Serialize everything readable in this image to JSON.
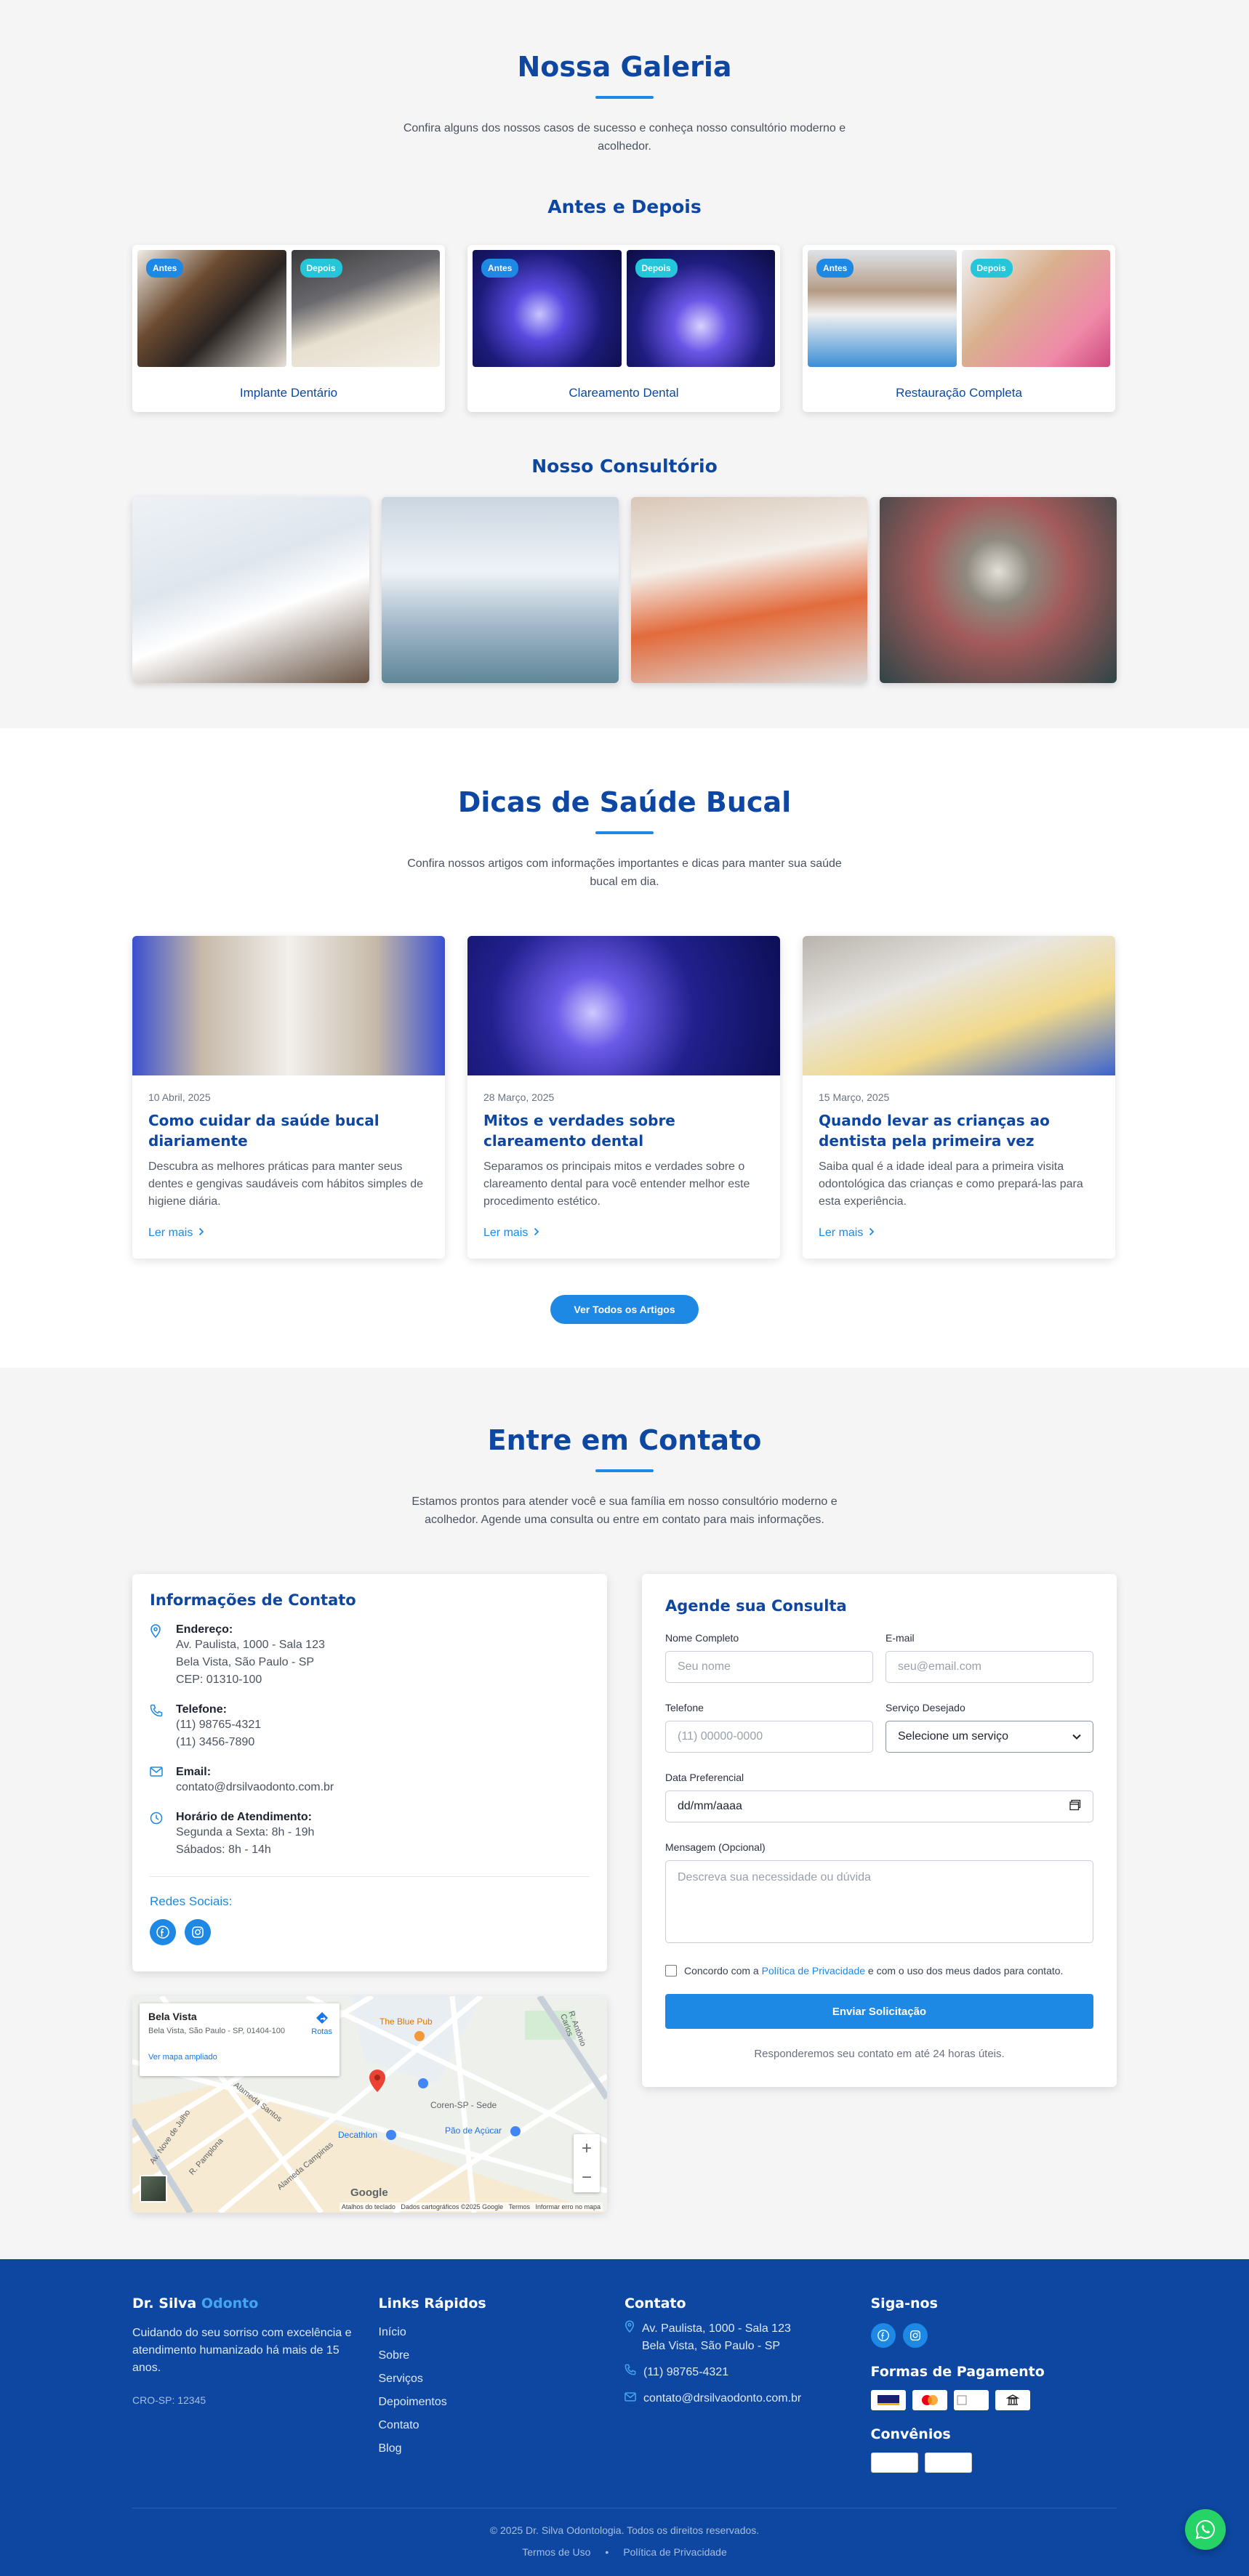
{
  "gallery": {
    "title": "Nossa Galeria",
    "subtitle": "Confira alguns dos nossos casos de sucesso e conheça nosso consultório moderno e acolhedor.",
    "before_after_title": "Antes e Depois",
    "badge_before": "Antes",
    "badge_after": "Depois",
    "cases": [
      {
        "label": "Implante Dentário"
      },
      {
        "label": "Clareamento Dental"
      },
      {
        "label": "Restauração Completa"
      }
    ],
    "office_title": "Nosso Consultório"
  },
  "blog": {
    "title": "Dicas de Saúde Bucal",
    "subtitle": "Confira nossos artigos com informações importantes e dicas para manter sua saúde bucal em dia.",
    "read_more": "Ler mais",
    "posts": [
      {
        "date": "10 Abril, 2025",
        "title": "Como cuidar da saúde bucal diariamente",
        "excerpt": "Descubra as melhores práticas para manter seus dentes e gengivas saudáveis com hábitos simples de higiene diária."
      },
      {
        "date": "28 Março, 2025",
        "title": "Mitos e verdades sobre clareamento dental",
        "excerpt": "Separamos os principais mitos e verdades sobre o clareamento dental para você entender melhor este procedimento estético."
      },
      {
        "date": "15 Março, 2025",
        "title": "Quando levar as crianças ao dentista pela primeira vez",
        "excerpt": "Saiba qual é a idade ideal para a primeira visita odontológica das crianças e como prepará-las para esta experiência."
      }
    ],
    "all_button": "Ver Todos os Artigos"
  },
  "contact": {
    "title": "Entre em Contato",
    "subtitle": "Estamos prontos para atender você e sua família em nosso consultório moderno e acolhedor. Agende uma consulta ou entre em contato para mais informações.",
    "info_title": "Informações de Contato",
    "address_label": "Endereço:",
    "address_lines": [
      "Av. Paulista, 1000 - Sala 123",
      "Bela Vista, São Paulo - SP",
      "CEP: 01310-100"
    ],
    "phone_label": "Telefone:",
    "phone_lines": [
      "(11) 98765-4321",
      "(11) 3456-7890"
    ],
    "email_label": "Email:",
    "email": "contato@drsilvaodonto.com.br",
    "hours_label": "Horário de Atendimento:",
    "hours_lines": [
      "Segunda a Sexta: 8h - 19h",
      "Sábados: 8h - 14h"
    ],
    "social_title": "Redes Sociais:",
    "map": {
      "place": "Bela Vista",
      "place_address": "Bela Vista, São Paulo - SP, 01404-100",
      "directions": "Rotas",
      "larger_map": "Ver mapa ampliado",
      "poi_1": "The Blue Pub",
      "poi_2": "Coren-SP - Sede",
      "poi_3": "Decathlon",
      "poi_4": "Pão de Açúcar",
      "street_1": "Alameda Santos",
      "street_2": "R. Pamplona",
      "street_3": "Alameda Campinas",
      "street_4": "Av. Nove de Julho",
      "street_5": "R. Antônio Carlos",
      "brand": "Google",
      "attribution": "Atalhos do teclado   Dados cartográficos ©2025 Google   Termos   Informar erro no mapa"
    },
    "form": {
      "title": "Agende sua Consulta",
      "name_label": "Nome Completo",
      "name_placeholder": "Seu nome",
      "email_label": "E-mail",
      "email_placeholder": "seu@email.com",
      "phone_label": "Telefone",
      "phone_placeholder": "(11) 00000-0000",
      "service_label": "Serviço Desejado",
      "service_value": "Selecione um serviço",
      "date_label": "Data Preferencial",
      "date_value": "dd/mm/aaaa",
      "message_label": "Mensagem (Opcional)",
      "message_placeholder": "Descreva sua necessidade ou dúvida",
      "consent_pre": "Concordo com a",
      "consent_link": "Política de Privacidade",
      "consent_post": "e com o uso dos meus dados para contato.",
      "submit": "Enviar Solicitação",
      "note": "Responderemos seu contato em até 24 horas úteis."
    }
  },
  "footer": {
    "brand_a": "Dr. Silva",
    "brand_b": "Odonto",
    "about": "Cuidando do seu sorriso com excelência e atendimento humanizado há mais de 15 anos.",
    "cro": "CRO-SP: 12345",
    "links_title": "Links Rápidos",
    "links": [
      "Início",
      "Sobre",
      "Serviços",
      "Depoimentos",
      "Contato",
      "Blog"
    ],
    "contact_title": "Contato",
    "address": "Av. Paulista, 1000 - Sala 123",
    "address2": "Bela Vista, São Paulo - SP",
    "phone": "(11) 98765-4321",
    "email": "contato@drsilvaodonto.com.br",
    "follow_title": "Siga-nos",
    "payment_title": "Formas de Pagamento",
    "insurance_title": "Convênios",
    "copyright": "© 2025 Dr. Silva Odontologia. Todos os direitos reservados.",
    "terms": "Termos de Uso",
    "privacy": "Política de Privacidade"
  },
  "colors": {
    "primary": "#1e88e5",
    "dark_blue": "#0d47a1",
    "accent_cyan": "#26c6da",
    "whatsapp": "#25d366"
  }
}
